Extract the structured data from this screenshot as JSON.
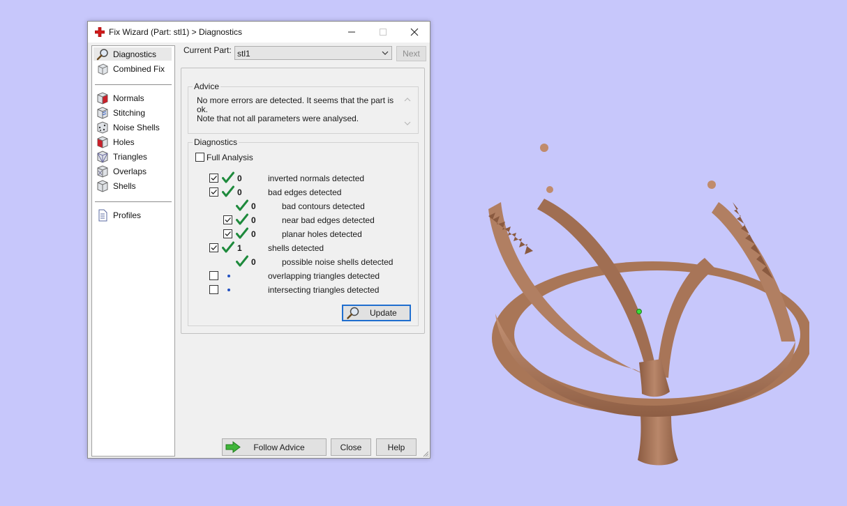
{
  "window": {
    "title": "Fix Wizard (Part: stl1) > Diagnostics"
  },
  "nav": {
    "items": [
      {
        "label": "Diagnostics",
        "icon": "magnifier-icon",
        "selected": true
      },
      {
        "label": "Combined Fix",
        "icon": "cube-icon"
      },
      {
        "label": "Normals",
        "icon": "normals-cube-icon"
      },
      {
        "label": "Stitching",
        "icon": "stitching-cube-icon"
      },
      {
        "label": "Noise Shells",
        "icon": "noise-shells-icon"
      },
      {
        "label": "Holes",
        "icon": "holes-cube-icon"
      },
      {
        "label": "Triangles",
        "icon": "triangles-cube-icon"
      },
      {
        "label": "Overlaps",
        "icon": "overlaps-cube-icon"
      },
      {
        "label": "Shells",
        "icon": "shells-cube-icon"
      },
      {
        "label": "Profiles",
        "icon": "document-icon"
      }
    ]
  },
  "top": {
    "current_part_label": "Current Part:",
    "current_part_value": "stl1",
    "next_label": "Next"
  },
  "advice": {
    "title": "Advice",
    "line1": "No more errors are detected. It seems that the part is ok.",
    "line2": "Note that not all parameters were analysed."
  },
  "diagnostics": {
    "title": "Diagnostics",
    "full_analysis_label": "Full Analysis",
    "rows": [
      {
        "checkbox": true,
        "checked": true,
        "status": "ok",
        "count": "0",
        "label": "inverted normals detected",
        "indent": 0
      },
      {
        "checkbox": true,
        "checked": true,
        "status": "ok",
        "count": "0",
        "label": "bad edges detected",
        "indent": 0
      },
      {
        "checkbox": false,
        "checked": false,
        "status": "ok",
        "count": "0",
        "label": "bad contours detected",
        "indent": 1
      },
      {
        "checkbox": true,
        "checked": true,
        "status": "ok",
        "count": "0",
        "label": "near bad edges detected",
        "indent": 1
      },
      {
        "checkbox": true,
        "checked": true,
        "status": "ok",
        "count": "0",
        "label": "planar holes detected",
        "indent": 1
      },
      {
        "checkbox": true,
        "checked": true,
        "status": "ok",
        "count": "1",
        "label": "shells detected",
        "indent": 0
      },
      {
        "checkbox": false,
        "checked": false,
        "status": "ok",
        "count": "0",
        "label": "possible noise shells detected",
        "indent": 1
      },
      {
        "checkbox": true,
        "checked": false,
        "status": "pending",
        "count": "",
        "label": "overlapping triangles detected",
        "indent": 0
      },
      {
        "checkbox": true,
        "checked": false,
        "status": "pending",
        "count": "",
        "label": "intersecting triangles detected",
        "indent": 0
      }
    ],
    "update_label": "Update"
  },
  "buttons": {
    "follow_advice": "Follow Advice",
    "close": "Close",
    "help": "Help"
  },
  "colors": {
    "desktop": "#c7c7fb",
    "model": "#b07f62",
    "check_green": "#1e8a3c",
    "focus_blue": "#1f6ecf"
  }
}
